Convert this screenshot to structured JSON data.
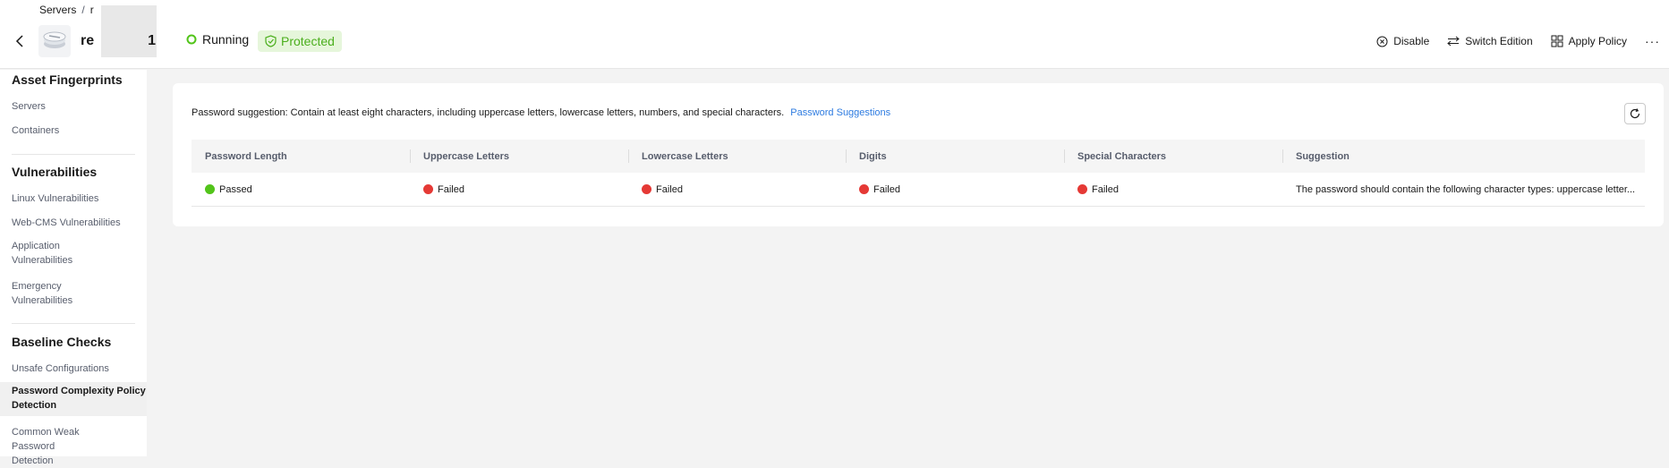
{
  "breadcrumb": {
    "parent": "Servers",
    "separator": "/",
    "current": "r"
  },
  "header": {
    "server_name_prefix": "re",
    "server_name_suffix": "1",
    "status_running": "Running",
    "status_protected": "Protected",
    "actions": {
      "disable": "Disable",
      "switch_edition": "Switch Edition",
      "apply_policy": "Apply Policy",
      "more": "···"
    }
  },
  "sidebar": {
    "groups": [
      {
        "title": "Asset Fingerprints",
        "items": [
          "Servers",
          "Containers"
        ]
      },
      {
        "title": "Vulnerabilities",
        "items": [
          "Linux Vulnerabilities",
          "Web-CMS Vulnerabilities",
          "Application Vulnerabilities",
          "Emergency Vulnerabilities"
        ]
      },
      {
        "title": "Baseline Checks",
        "items": [
          "Unsafe Configurations",
          "Password Complexity Policy Detection",
          "Common Weak Password Detection"
        ]
      }
    ]
  },
  "main": {
    "suggestion_text": "Password suggestion: Contain at least eight characters, including uppercase letters, lowercase letters, numbers, and special characters.",
    "suggestion_link": "Password Suggestions",
    "table": {
      "columns": [
        "Password Length",
        "Uppercase Letters",
        "Lowercase Letters",
        "Digits",
        "Special Characters",
        "Suggestion"
      ],
      "row": {
        "password_length": "Passed",
        "uppercase": "Failed",
        "lowercase": "Failed",
        "digits": "Failed",
        "special": "Failed",
        "suggestion": "The password should contain the following character types: uppercase letter..."
      }
    }
  },
  "colors": {
    "passed": "#52c41a",
    "failed": "#e53935",
    "link": "#2d7be0",
    "protected_bg": "#e6f6db",
    "protected_text": "#4caf1e",
    "running": "#52c41a"
  }
}
